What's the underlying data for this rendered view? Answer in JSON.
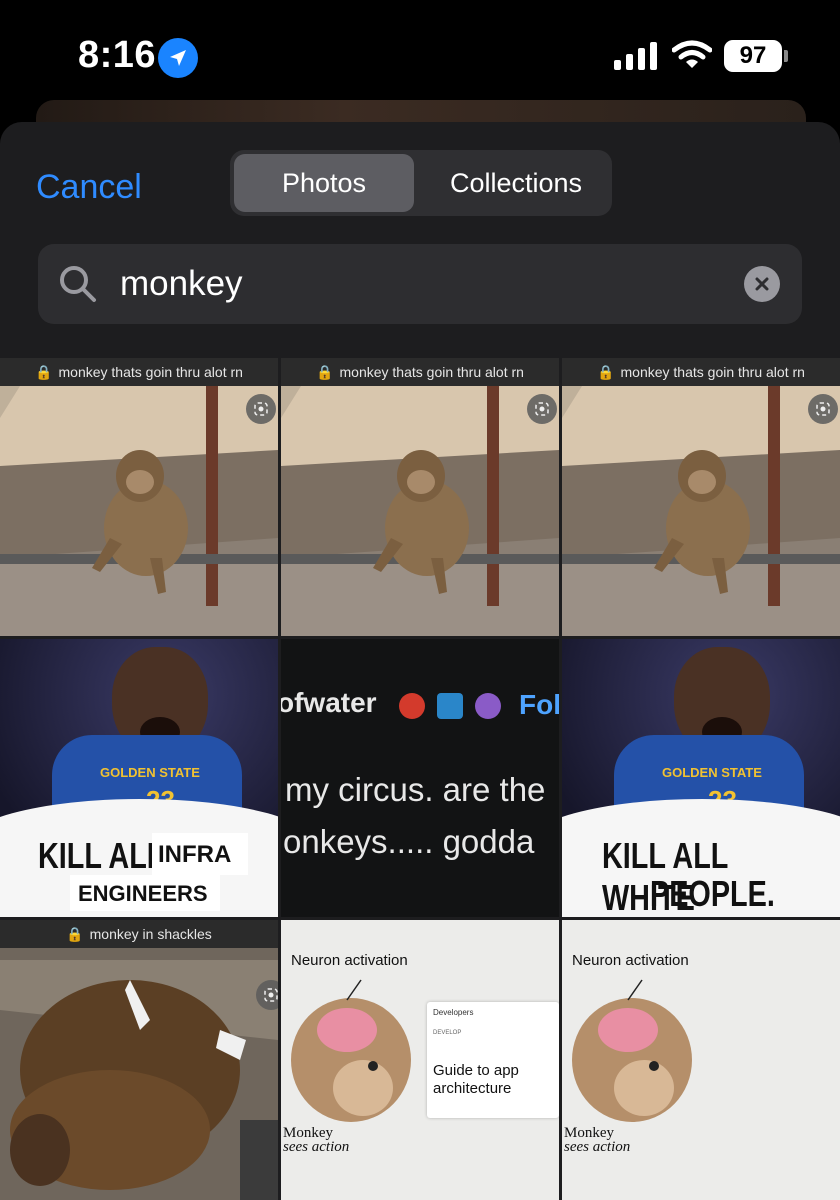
{
  "status_bar": {
    "time": "8:16",
    "battery": "97",
    "icons": [
      "location-arrow-icon",
      "cellular-signal-icon",
      "wifi-icon",
      "battery-icon"
    ]
  },
  "picker": {
    "cancel_label": "Cancel",
    "tabs": [
      {
        "label": "Photos",
        "selected": true
      },
      {
        "label": "Collections",
        "selected": false
      }
    ],
    "search": {
      "value": "monkey",
      "icon": "magnifier-icon",
      "clear_icon": "clear-x-icon"
    }
  },
  "colors": {
    "accent": "#2f8bff",
    "sheet_bg": "#1d1d1f",
    "search_bg": "#2d2d30",
    "segment_selected": "#5d5d62"
  },
  "results": [
    {
      "kind": "monkey-photo",
      "url_caption": "monkey thats goin thru alot rn"
    },
    {
      "kind": "monkey-photo",
      "url_caption": "monkey thats goin thru alot rn"
    },
    {
      "kind": "monkey-photo",
      "url_caption": "monkey thats goin thru alot rn"
    },
    {
      "kind": "jersey-meme",
      "line1": "KILL ALL",
      "patch1": "INFRA",
      "patch2": "ENGINEERS",
      "jersey_text": "GOLDEN STATE",
      "number": "23"
    },
    {
      "kind": "tweet-crop",
      "handle": "ofwater",
      "follow": "Fol",
      "line1": "my circus. are the",
      "line2": "onkeys..... godda"
    },
    {
      "kind": "jersey-meme",
      "line1": "KILL ALL WHITE",
      "line2": "PEOPLE.",
      "jersey_text": "GOLDEN STATE",
      "number": "23"
    },
    {
      "kind": "monkey-photo",
      "url_caption": "monkey in shackles"
    },
    {
      "kind": "neuron-meme",
      "title": "Neuron activation",
      "label1": "Monkey",
      "label2": "sees action",
      "card_brand": "Developers",
      "card_section": "DEVELOP",
      "card_title": "Guide to app architecture"
    },
    {
      "kind": "neuron-meme",
      "title": "Neuron activation",
      "label1": "Monkey",
      "label2": "sees action"
    }
  ]
}
